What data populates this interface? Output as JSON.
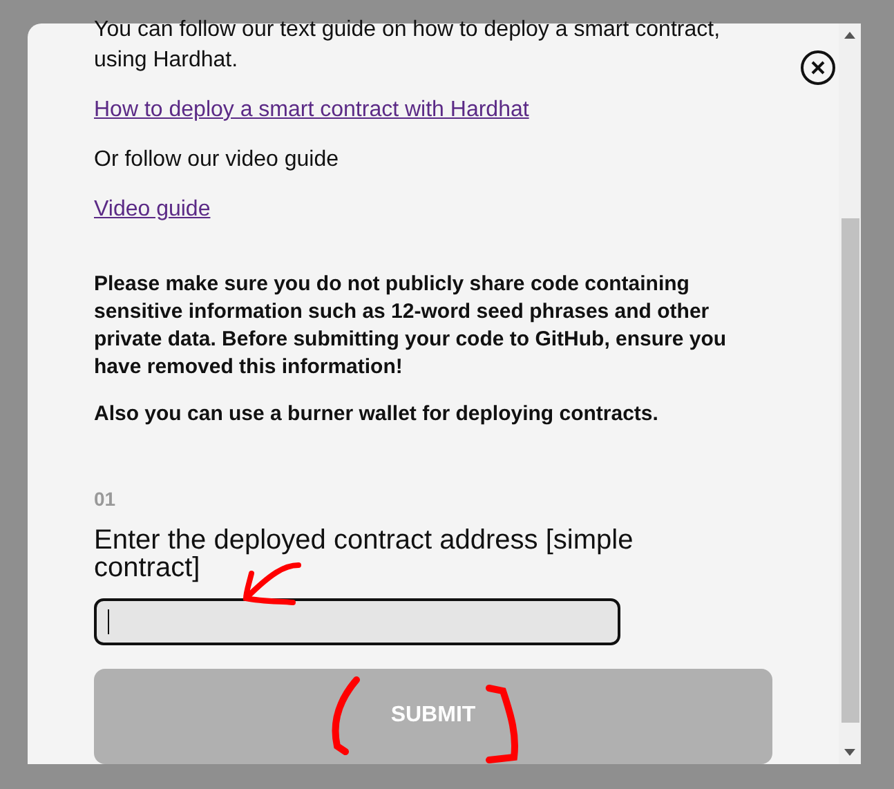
{
  "modal": {
    "intro": "You can follow our text guide on how to deploy a smart contract, using Hardhat.",
    "links_and_texts": [
      {
        "kind": "link",
        "text": "How to deploy a smart contract with Hardhat"
      },
      {
        "kind": "text",
        "text": "Or follow our video guide"
      },
      {
        "kind": "link",
        "text": "Video guide"
      }
    ],
    "warnings": [
      "Please make sure you do not publicly share code containing sensitive information such as 12-word seed phrases and other private data. Before submitting your code to GitHub, ensure you have removed this information!",
      "Also you can use a burner wallet for deploying contracts."
    ],
    "question": {
      "number": "01",
      "label": "Enter the deployed contract address [simple contract]",
      "focused": true
    },
    "submit": {
      "label": "SUBMIT",
      "disabled": true
    }
  }
}
